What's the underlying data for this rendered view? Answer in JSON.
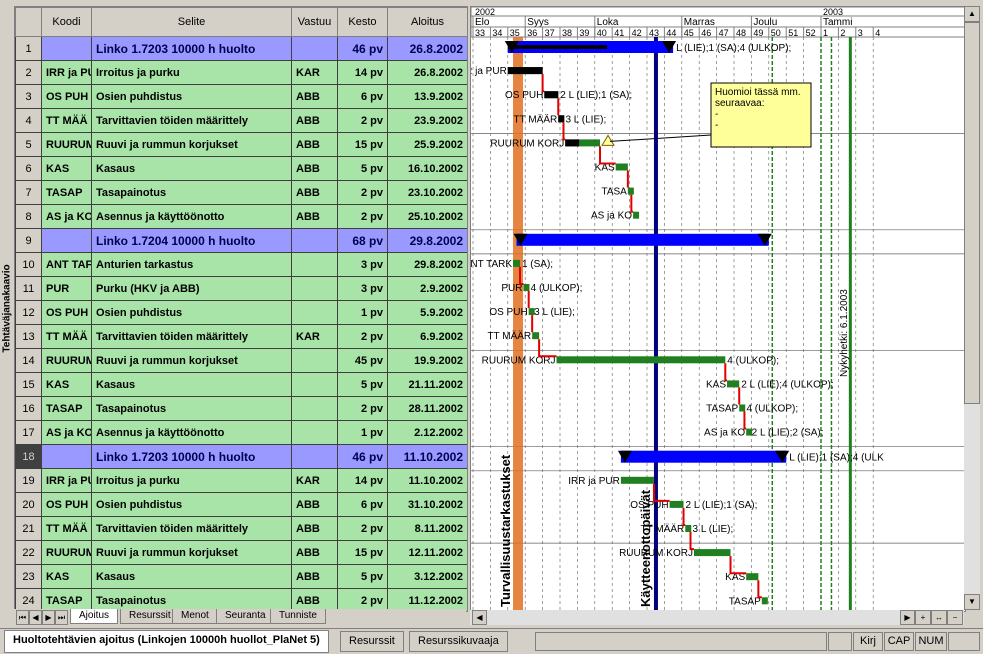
{
  "side_label": "Tehtäväjanakaavio",
  "columns": [
    "Koodi",
    "Selite",
    "Vastuu",
    "Kesto",
    "Aloitus"
  ],
  "rows": [
    {
      "n": "1",
      "type": "sum",
      "koodi": "",
      "selite": "Linko 1.7203  10000 h huolto",
      "vastuu": "",
      "kesto": "46 pv",
      "aloitus": "26.8.2002"
    },
    {
      "n": "2",
      "type": "task",
      "koodi": "IRR ja PU",
      "selite": "Irroitus ja purku",
      "vastuu": "KAR",
      "kesto": "14 pv",
      "aloitus": "26.8.2002"
    },
    {
      "n": "3",
      "type": "task",
      "koodi": "OS PUH",
      "selite": "Osien puhdistus",
      "vastuu": "ABB",
      "kesto": "6 pv",
      "aloitus": "13.9.2002"
    },
    {
      "n": "4",
      "type": "task",
      "koodi": "TT MÄÄ",
      "selite": "Tarvittavien töiden määrittely",
      "vastuu": "ABB",
      "kesto": "2 pv",
      "aloitus": "23.9.2002"
    },
    {
      "n": "5",
      "type": "task",
      "koodi": "RUURUM",
      "selite": "Ruuvi ja rummun korjukset",
      "vastuu": "ABB",
      "kesto": "15 pv",
      "aloitus": "25.9.2002"
    },
    {
      "n": "6",
      "type": "task",
      "koodi": "KAS",
      "selite": "Kasaus",
      "vastuu": "ABB",
      "kesto": "5 pv",
      "aloitus": "16.10.2002"
    },
    {
      "n": "7",
      "type": "task",
      "koodi": "TASAP",
      "selite": "Tasapainotus",
      "vastuu": "ABB",
      "kesto": "2 pv",
      "aloitus": "23.10.2002"
    },
    {
      "n": "8",
      "type": "task",
      "koodi": "AS ja KO",
      "selite": "Asennus ja käyttöönotto",
      "vastuu": "ABB",
      "kesto": "2 pv",
      "aloitus": "25.10.2002"
    },
    {
      "n": "9",
      "type": "sum",
      "koodi": "",
      "selite": "Linko 1.7204  10000 h huolto",
      "vastuu": "",
      "kesto": "68 pv",
      "aloitus": "29.8.2002"
    },
    {
      "n": "10",
      "type": "task",
      "koodi": "ANT TAF",
      "selite": "Anturien tarkastus",
      "vastuu": "",
      "kesto": "3 pv",
      "aloitus": "29.8.2002"
    },
    {
      "n": "11",
      "type": "task",
      "koodi": "PUR",
      "selite": "Purku (HKV ja ABB)",
      "vastuu": "",
      "kesto": "3 pv",
      "aloitus": "2.9.2002"
    },
    {
      "n": "12",
      "type": "task",
      "koodi": "OS PUH",
      "selite": "Osien puhdistus",
      "vastuu": "",
      "kesto": "1 pv",
      "aloitus": "5.9.2002"
    },
    {
      "n": "13",
      "type": "task",
      "koodi": "TT MÄÄ",
      "selite": "Tarvittavien töiden määrittely",
      "vastuu": "KAR",
      "kesto": "2 pv",
      "aloitus": "6.9.2002"
    },
    {
      "n": "14",
      "type": "task",
      "koodi": "RUURUM",
      "selite": "Ruuvi ja rummun korjukset",
      "vastuu": "",
      "kesto": "45 pv",
      "aloitus": "19.9.2002"
    },
    {
      "n": "15",
      "type": "task",
      "koodi": "KAS",
      "selite": "Kasaus",
      "vastuu": "",
      "kesto": "5 pv",
      "aloitus": "21.11.2002"
    },
    {
      "n": "16",
      "type": "task",
      "koodi": "TASAP",
      "selite": "Tasapainotus",
      "vastuu": "",
      "kesto": "2 pv",
      "aloitus": "28.11.2002"
    },
    {
      "n": "17",
      "type": "task",
      "koodi": "AS ja KO",
      "selite": "Asennus ja käyttöönotto",
      "vastuu": "",
      "kesto": "1 pv",
      "aloitus": "2.12.2002"
    },
    {
      "n": "18",
      "type": "sum",
      "sel": true,
      "koodi": "",
      "selite": "Linko 1.7203  10000 h huolto",
      "vastuu": "",
      "kesto": "46 pv",
      "aloitus": "11.10.2002"
    },
    {
      "n": "19",
      "type": "task",
      "koodi": "IRR ja PU",
      "selite": "Irroitus ja purku",
      "vastuu": "KAR",
      "kesto": "14 pv",
      "aloitus": "11.10.2002"
    },
    {
      "n": "20",
      "type": "task",
      "koodi": "OS PUH",
      "selite": "Osien puhdistus",
      "vastuu": "ABB",
      "kesto": "6 pv",
      "aloitus": "31.10.2002"
    },
    {
      "n": "21",
      "type": "task",
      "koodi": "TT MÄÄ",
      "selite": "Tarvittavien töiden määrittely",
      "vastuu": "ABB",
      "kesto": "2 pv",
      "aloitus": "8.11.2002"
    },
    {
      "n": "22",
      "type": "task",
      "koodi": "RUURUM",
      "selite": "Ruuvi ja rummun korjukset",
      "vastuu": "ABB",
      "kesto": "15 pv",
      "aloitus": "12.11.2002"
    },
    {
      "n": "23",
      "type": "task",
      "koodi": "KAS",
      "selite": "Kasaus",
      "vastuu": "ABB",
      "kesto": "5 pv",
      "aloitus": "3.12.2002"
    },
    {
      "n": "24",
      "type": "task",
      "koodi": "TASAP",
      "selite": "Tasapainotus",
      "vastuu": "ABB",
      "kesto": "2 pv",
      "aloitus": "11.12.2002"
    }
  ],
  "view_tabs": [
    "Ajoitus",
    "Resurssit",
    "Menot",
    "Seuranta",
    "Tunniste"
  ],
  "timeline": {
    "years": [
      {
        "label": "2002",
        "week": 33
      },
      {
        "label": "2003",
        "week": 53
      }
    ],
    "months": [
      {
        "label": "Elo",
        "week": 33
      },
      {
        "label": "Syys",
        "week": 36
      },
      {
        "label": "Loka",
        "week": 40
      },
      {
        "label": "Marras",
        "week": 45
      },
      {
        "label": "Joulu",
        "week": 49
      },
      {
        "label": "Tammi",
        "week": 53
      }
    ],
    "weeks": [
      "33",
      "34",
      "35",
      "36",
      "37",
      "38",
      "39",
      "40",
      "41",
      "42",
      "43",
      "44",
      "45",
      "46",
      "47",
      "48",
      "49",
      "50",
      "51",
      "52",
      "1",
      "2",
      "3",
      "4"
    ]
  },
  "gantt_bars": [
    {
      "row": 1,
      "kind": "sum",
      "start": 35.0,
      "end": 44.5,
      "label": "L (LIE);1 (SA);4 (ULKOP);",
      "label_side": "right"
    },
    {
      "row": 2,
      "kind": "task",
      "start": 35.0,
      "end": 37.0,
      "label": "IRR ja PUR",
      "label_side": "left",
      "done": 1.0
    },
    {
      "row": 3,
      "kind": "task",
      "start": 37.1,
      "end": 37.9,
      "label": "OS PUH",
      "label_side": "left",
      "right": "2 L (LIE);1 (SA);",
      "done": 1.0
    },
    {
      "row": 4,
      "kind": "task",
      "start": 37.9,
      "end": 38.2,
      "label": "TT MÄÄR",
      "label_side": "left",
      "right": "3 L (LIE);",
      "done": 1.0
    },
    {
      "row": 5,
      "kind": "task",
      "start": 38.3,
      "end": 40.3,
      "label": "RUURUM KORJ",
      "label_side": "left",
      "done": 0.4,
      "flag": "yellow"
    },
    {
      "row": 6,
      "kind": "task",
      "start": 41.2,
      "end": 41.9,
      "label": "KAS",
      "label_side": "left",
      "done": 0.0
    },
    {
      "row": 7,
      "kind": "task",
      "start": 41.9,
      "end": 42.1,
      "label": "TASA",
      "label_side": "left",
      "done": 0.0
    },
    {
      "row": 8,
      "kind": "task",
      "start": 42.2,
      "end": 42.4,
      "label": "AS ja KO",
      "label_side": "left",
      "done": 0.0
    },
    {
      "row": 9,
      "kind": "sum",
      "start": 35.5,
      "end": 50.0,
      "label": "",
      "label_side": "right"
    },
    {
      "row": 10,
      "kind": "task",
      "start": 35.3,
      "end": 35.7,
      "label": "ANT TARK",
      "label_side": "left",
      "right": "1 (SA);",
      "done": 0.0
    },
    {
      "row": 11,
      "kind": "task",
      "start": 35.9,
      "end": 36.2,
      "label": "PUR",
      "label_side": "left",
      "right": "4 (ULKOP);",
      "done": 0.0
    },
    {
      "row": 12,
      "kind": "task",
      "start": 36.2,
      "end": 36.4,
      "label": "OS PUH",
      "label_side": "left",
      "right": "3 L (LIE);",
      "done": 0.0
    },
    {
      "row": 13,
      "kind": "task",
      "start": 36.4,
      "end": 36.8,
      "label": "TT MÄÄR",
      "label_side": "left",
      "done": 0.0
    },
    {
      "row": 14,
      "kind": "task",
      "start": 37.8,
      "end": 47.5,
      "label": "RUURUM KORJ",
      "label_side": "left",
      "right": "4 (ULKOP);",
      "done": 0.0
    },
    {
      "row": 15,
      "kind": "task",
      "start": 47.6,
      "end": 48.3,
      "label": "KAS",
      "label_side": "left",
      "right": "2 L (LIE);4 (ULKOP);",
      "done": 0.0
    },
    {
      "row": 16,
      "kind": "task",
      "start": 48.3,
      "end": 48.6,
      "label": "TASAP",
      "label_side": "left",
      "right": "4 (ULKOP);",
      "done": 0.0
    },
    {
      "row": 17,
      "kind": "task",
      "start": 48.7,
      "end": 48.9,
      "label": "AS ja KO",
      "label_side": "left",
      "right": "2 L (LIE);2 (SA);",
      "done": 0.0
    },
    {
      "row": 18,
      "kind": "sum",
      "start": 41.5,
      "end": 51.0,
      "label": "L (LIE);1 (SA);4 (ULK",
      "label_side": "right"
    },
    {
      "row": 19,
      "kind": "task",
      "start": 41.5,
      "end": 43.4,
      "label": "IRR ja PUR",
      "label_side": "left",
      "done": 0.0
    },
    {
      "row": 20,
      "kind": "task",
      "start": 44.3,
      "end": 45.1,
      "label": "OS PUH",
      "label_side": "left",
      "right": "2 L (LIE);1 (SA);",
      "done": 0.0
    },
    {
      "row": 21,
      "kind": "task",
      "start": 45.2,
      "end": 45.5,
      "label": "TT MÄÄR",
      "label_side": "left",
      "right": "3 L (LIE);",
      "done": 0.0
    },
    {
      "row": 22,
      "kind": "task",
      "start": 45.7,
      "end": 47.8,
      "label": "RUURUM KORJ",
      "label_side": "left",
      "done": 0.0
    },
    {
      "row": 23,
      "kind": "task",
      "start": 48.7,
      "end": 49.4,
      "label": "KAS",
      "label_side": "left",
      "done": 0.0
    },
    {
      "row": 24,
      "kind": "task",
      "start": 49.6,
      "end": 49.8,
      "label": "TASAP",
      "label_side": "left",
      "done": 0.0
    }
  ],
  "vertical_markers": [
    {
      "label": "Turvallisuustarkastukset",
      "week": 35.3,
      "color": "#e07020"
    },
    {
      "label": "Käytteenottopäivät",
      "week": 43.4,
      "color": "#000080"
    },
    {
      "label": "Nykyhetki: 6.1.2003",
      "week": 54.6,
      "color": "#208020"
    }
  ],
  "note": {
    "lines": [
      "Huomioi tässä mm.",
      "seuraavaa:",
      "-",
      "-"
    ]
  },
  "sheet_tabs": [
    "Huoltotehtävien ajoitus (Linkojen 10000h huollot_PlaNet 5)",
    "Resurssit",
    "Resurssikuvaaja"
  ],
  "status_cells": [
    "Kirj",
    "CAP",
    "NUM"
  ]
}
